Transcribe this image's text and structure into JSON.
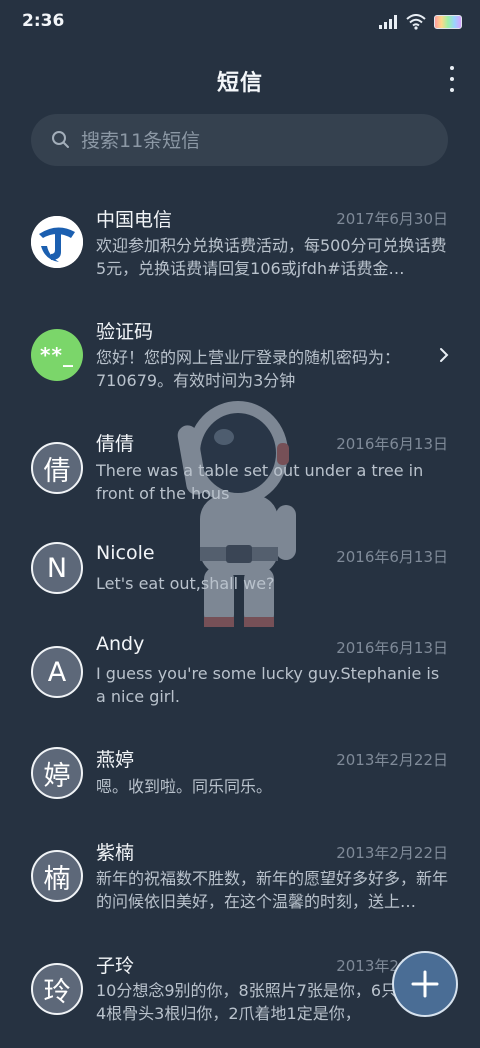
{
  "status": {
    "time": "2:36"
  },
  "header": {
    "title": "短信"
  },
  "search": {
    "placeholder": "搜索11条短信"
  },
  "colors": {
    "background": "#263241",
    "accent": "#4a6d95",
    "code_avatar": "#7bd66a"
  },
  "messages": [
    {
      "name": "中国电信",
      "date": "2017年6月30日",
      "preview": "欢迎参加积分兑换话费活动，每500分可兑换话费5元，兑换话费请回复106或jfdh#话费金…",
      "avatar": ""
    },
    {
      "name": "验证码",
      "date": "",
      "preview": "您好！您的网上营业厅登录的随机密码为：710679。有效时间为3分钟",
      "avatar": "**_"
    },
    {
      "name": "倩倩",
      "date": "2016年6月13日",
      "preview": "There was a table set out under a tree in front of the hous",
      "avatar": "倩"
    },
    {
      "name": "Nicole",
      "date": "2016年6月13日",
      "preview": "Let's eat out,shall we?",
      "avatar": "N"
    },
    {
      "name": "Andy",
      "date": "2016年6月13日",
      "preview": "I guess you're some lucky guy.Stephanie is a nice girl.",
      "avatar": "A"
    },
    {
      "name": "燕婷",
      "date": "2013年2月22日",
      "preview": "嗯。收到啦。同乐同乐。",
      "avatar": "婷"
    },
    {
      "name": "紫楠",
      "date": "2013年2月22日",
      "preview": "新年的祝福数不胜数，新年的愿望好多好多，新年的问候依旧美好，在这个温馨的时刻，送上…",
      "avatar": "楠"
    },
    {
      "name": "子玲",
      "date": "2013年2月22日",
      "preview": "10分想念9别的你，8张照片7张是你，6只像你，4根骨头3根归你，2爪着地1定是你，",
      "avatar": "玲"
    }
  ]
}
